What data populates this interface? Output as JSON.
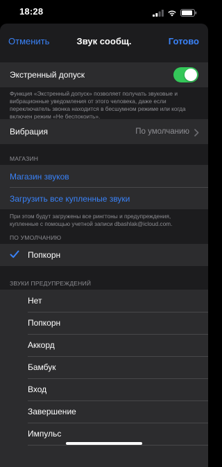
{
  "status_bar": {
    "time": "18:28"
  },
  "nav": {
    "cancel_label": "Отменить",
    "title": "Звук сообщ.",
    "done_label": "Готово"
  },
  "emergency": {
    "label": "Экстренный допуск",
    "enabled": true,
    "footnote": "Функция «Экстренный допуск» позволяет получать звуковые и вибрационные уведомления от этого человека, даже если переключатель звонка находится в бесшумном режиме или когда включен режим «Не беспокоить»."
  },
  "vibration": {
    "label": "Вибрация",
    "value": "По умолчанию"
  },
  "store": {
    "header": "МАГАЗИН",
    "tone_store_label": "Магазин звуков",
    "download_all_label": "Загрузить все купленные звуки",
    "footnote": "При этом будут загружены все рингтоны и предупреждения, купленные с помощью учетной записи dbashlak@icloud.com."
  },
  "default_section": {
    "header": "ПО УМОЛЧАНИЮ",
    "selected_tone": "Попкорн"
  },
  "alert_tones": {
    "header": "ЗВУКИ ПРЕДУПРЕЖДЕНИЙ",
    "items": [
      "Нет",
      "Попкорн",
      "Аккорд",
      "Бамбук",
      "Вход",
      "Завершение",
      "Импульс"
    ]
  },
  "colors": {
    "accent": "#3a82f7",
    "toggle_on": "#34c759",
    "sheet_bg": "#1c1c1e",
    "cell_bg": "#2c2c2e",
    "secondary_text": "#8e8e93"
  }
}
